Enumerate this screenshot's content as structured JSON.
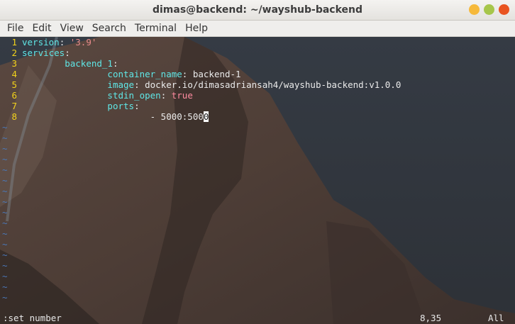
{
  "window": {
    "title": "dimas@backend: ~/wayshub-backend"
  },
  "menu": [
    "File",
    "Edit",
    "View",
    "Search",
    "Terminal",
    "Help"
  ],
  "editor": {
    "lines": [
      {
        "num": "1",
        "indent": "",
        "key": "version",
        "sep": ": ",
        "value": "'3.9'",
        "type": "str"
      },
      {
        "num": "2",
        "indent": "",
        "key": "services",
        "sep": ":",
        "value": "",
        "type": "txt"
      },
      {
        "num": "3",
        "indent": "        ",
        "key": "backend_1",
        "sep": ":",
        "value": "",
        "type": "txt"
      },
      {
        "num": "4",
        "indent": "                ",
        "key": "container_name",
        "sep": ": ",
        "value": "backend-1",
        "type": "txt"
      },
      {
        "num": "5",
        "indent": "                ",
        "key": "image",
        "sep": ": ",
        "value": "docker.io/dimasadriansah4/wayshub-backend:v1.0.0",
        "type": "txt"
      },
      {
        "num": "6",
        "indent": "                ",
        "key": "stdin_open",
        "sep": ": ",
        "value": "true",
        "type": "bool"
      },
      {
        "num": "7",
        "indent": "                ",
        "key": "ports",
        "sep": ":",
        "value": "",
        "type": "txt"
      },
      {
        "num": "8",
        "indent": "                        ",
        "key": "",
        "sep": "",
        "value": "- 5000:500",
        "cursor": "0",
        "type": "txt"
      }
    ],
    "tilde": "~",
    "tilde_count": 17
  },
  "status": {
    "command": ":set number",
    "position": "8,35",
    "scroll": "All"
  }
}
